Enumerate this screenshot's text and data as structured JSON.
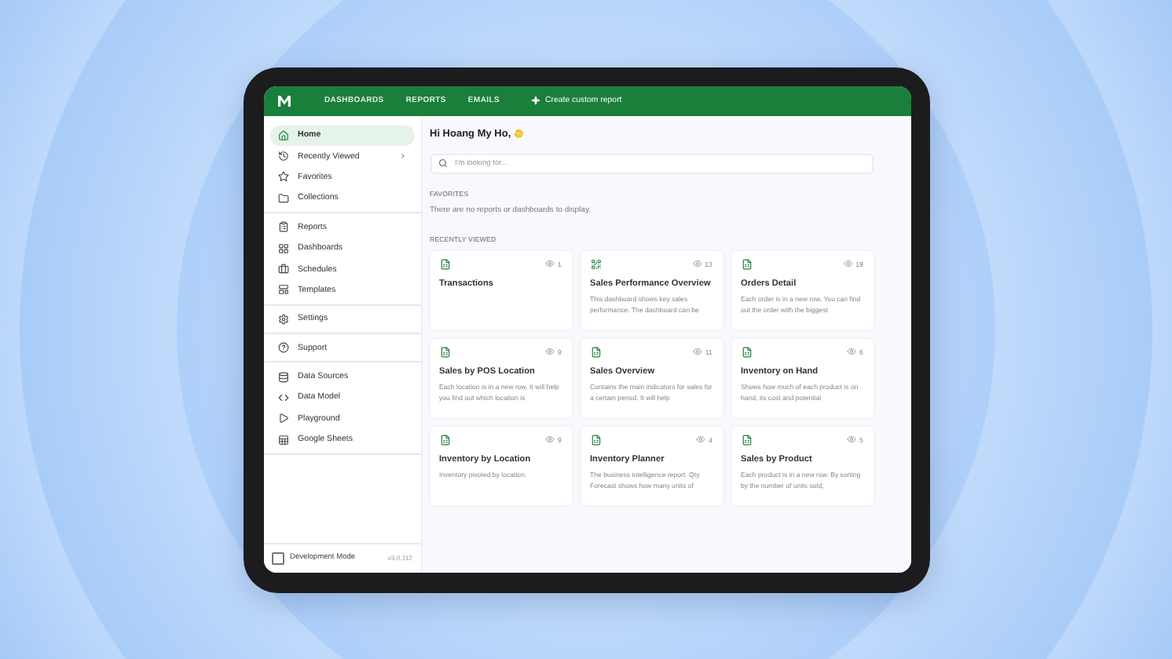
{
  "topbar": {
    "nav": [
      {
        "label": "DASHBOARDS",
        "selected": false
      },
      {
        "label": "REPORTS",
        "selected": false
      },
      {
        "label": "EMAILS",
        "selected": false
      }
    ],
    "create_label": "Create custom report"
  },
  "sidebar": {
    "groups": [
      {
        "items": [
          {
            "label": "Home",
            "selected": true,
            "submenu": false
          },
          {
            "label": "Recently Viewed",
            "selected": false,
            "submenu": true
          },
          {
            "label": "Favorites",
            "selected": false,
            "submenu": false
          },
          {
            "label": "Collections",
            "selected": false,
            "submenu": false
          }
        ]
      },
      {
        "items": [
          {
            "label": "Reports",
            "selected": false,
            "submenu": false
          },
          {
            "label": "Dashboards",
            "selected": false,
            "submenu": false
          },
          {
            "label": "Schedules",
            "selected": false,
            "submenu": false
          },
          {
            "label": "Templates",
            "selected": false,
            "submenu": false
          }
        ]
      },
      {
        "items": [
          {
            "label": "Settings",
            "selected": false,
            "submenu": false
          }
        ]
      },
      {
        "items": [
          {
            "label": "Support",
            "selected": false,
            "submenu": false
          }
        ]
      },
      {
        "items": [
          {
            "label": "Data Sources",
            "selected": false,
            "submenu": false
          },
          {
            "label": "Data Model",
            "selected": false,
            "submenu": false
          },
          {
            "label": "Playground",
            "selected": false,
            "submenu": false
          },
          {
            "label": "Google Sheets",
            "selected": false,
            "submenu": false
          }
        ]
      }
    ],
    "dev_mode": {
      "label": "Development Mode",
      "checked": false
    },
    "version": "v3.0.112"
  },
  "main": {
    "greeting": "Hi Hoang My Ho,",
    "search": {
      "placeholder": "I'm looking for..."
    },
    "favorites": {
      "heading": "FAVORITES",
      "empty_text": "There are no reports or dashboards to display."
    },
    "recent": {
      "heading": "RECENTLY VIEWED",
      "cards": [
        {
          "kind": "report",
          "views": "1",
          "title": "Transactions"
        },
        {
          "kind": "dashboard",
          "views": "13",
          "title": "Sales Performance Overview",
          "description": "This dashboard shows key sales performance. The dashboard can be"
        },
        {
          "kind": "report",
          "views": "19",
          "title": "Orders Detail",
          "description": "Each order is in a new row. You can find out the order with the biggest"
        },
        {
          "kind": "report",
          "views": "9",
          "title": "Sales by POS Location",
          "description": "Each location is in a new row. It will help you find out which location is"
        },
        {
          "kind": "report",
          "views": "11",
          "title": "Sales Overview",
          "description": "Contains the main indicators for sales for a certain period. It will help"
        },
        {
          "kind": "report",
          "views": "6",
          "title": "Inventory on Hand",
          "description": "Shows how much of each product is on hand, its cost and potential"
        },
        {
          "kind": "report",
          "views": "9",
          "title": "Inventory by Location",
          "description": "Inventory pivoted by location."
        },
        {
          "kind": "report",
          "views": "4",
          "title": "Inventory Planner",
          "description": "The business intelligence report. Qty Forecast shows how many units of"
        },
        {
          "kind": "report",
          "views": "5",
          "title": "Sales by Product",
          "description": "Each product is in a new row. By sorting by the number of units sold,"
        }
      ]
    }
  }
}
